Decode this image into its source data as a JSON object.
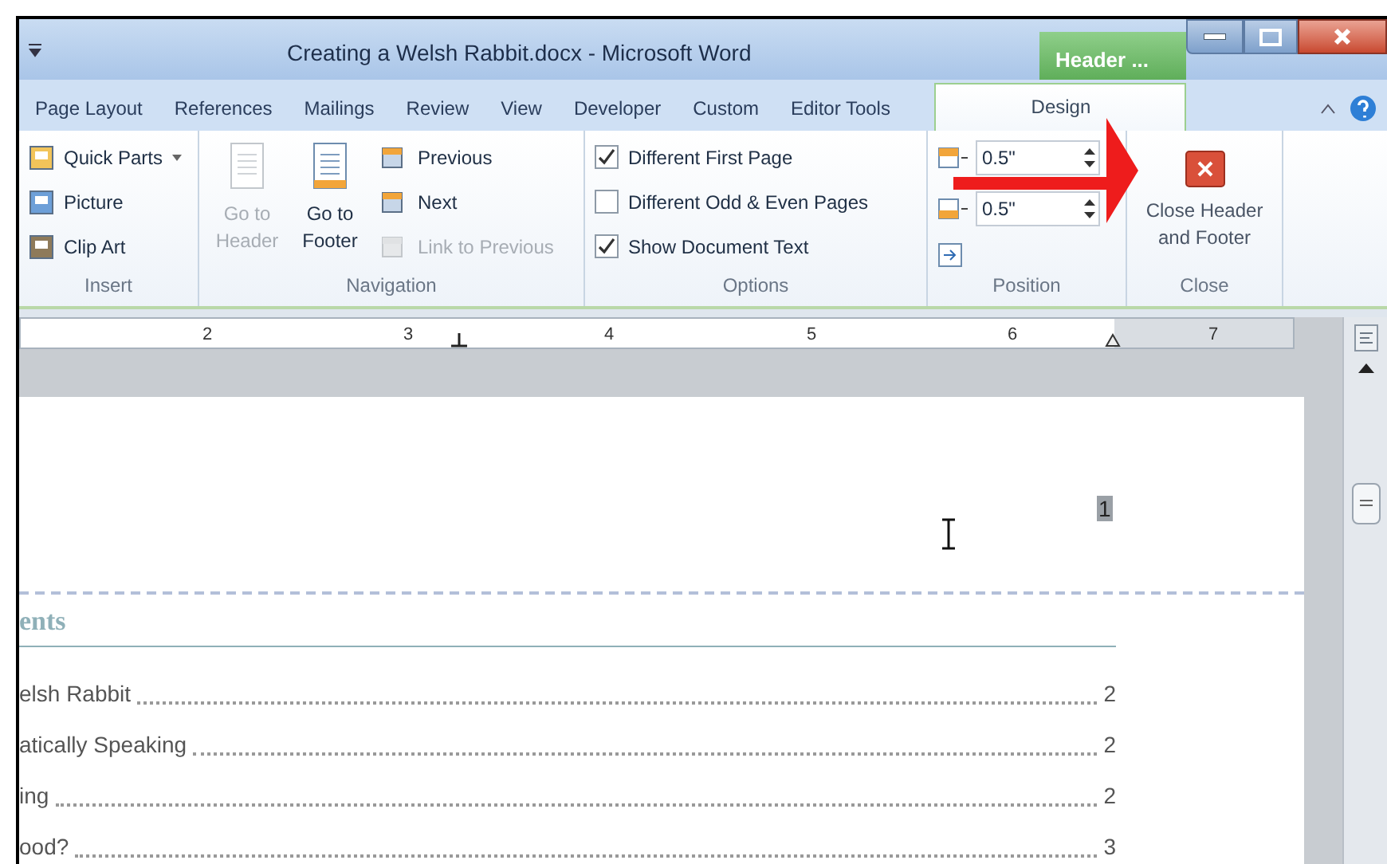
{
  "window": {
    "title": "Creating a Welsh Rabbit.docx - Microsoft Word",
    "contextual_tab": "Header ..."
  },
  "tabs": [
    {
      "label": "Page Layout",
      "selected": false
    },
    {
      "label": "References",
      "selected": false
    },
    {
      "label": "Mailings",
      "selected": false
    },
    {
      "label": "Review",
      "selected": false
    },
    {
      "label": "View",
      "selected": false
    },
    {
      "label": "Developer",
      "selected": false
    },
    {
      "label": "Custom",
      "selected": false
    },
    {
      "label": "Editor Tools",
      "selected": false
    },
    {
      "label": "Design",
      "selected": true
    }
  ],
  "ribbon": {
    "insert": {
      "label": "Insert",
      "items": [
        {
          "label": "Quick Parts",
          "dropdown": true
        },
        {
          "label": "Picture",
          "dropdown": false
        },
        {
          "label": "Clip Art",
          "dropdown": false
        }
      ]
    },
    "navigation": {
      "label": "Navigation",
      "large": [
        {
          "label": "Go to Header",
          "disabled": true
        },
        {
          "label": "Go to Footer",
          "disabled": false
        }
      ],
      "small": [
        {
          "label": "Previous",
          "disabled": false
        },
        {
          "label": "Next",
          "disabled": false
        },
        {
          "label": "Link to Previous",
          "disabled": true
        }
      ]
    },
    "options": {
      "label": "Options",
      "items": [
        {
          "label": "Different First Page",
          "checked": true
        },
        {
          "label": "Different Odd & Even Pages",
          "checked": false
        },
        {
          "label": "Show Document Text",
          "checked": true
        }
      ]
    },
    "position": {
      "label": "Position",
      "header_from_top": "0.5\"",
      "footer_from_bottom": "0.5\""
    },
    "close": {
      "label": "Close",
      "button": "Close Header and Footer"
    }
  },
  "ruler": {
    "numbers": [
      "2",
      "3",
      "4",
      "5",
      "6",
      "7"
    ]
  },
  "document": {
    "header_page_number": "1",
    "toc_heading": "ents",
    "toc": [
      {
        "title": "elsh Rabbit",
        "page": "2"
      },
      {
        "title": "atically Speaking",
        "page": "2"
      },
      {
        "title": "ing",
        "page": "2"
      },
      {
        "title": "ood?",
        "page": "3"
      }
    ]
  }
}
